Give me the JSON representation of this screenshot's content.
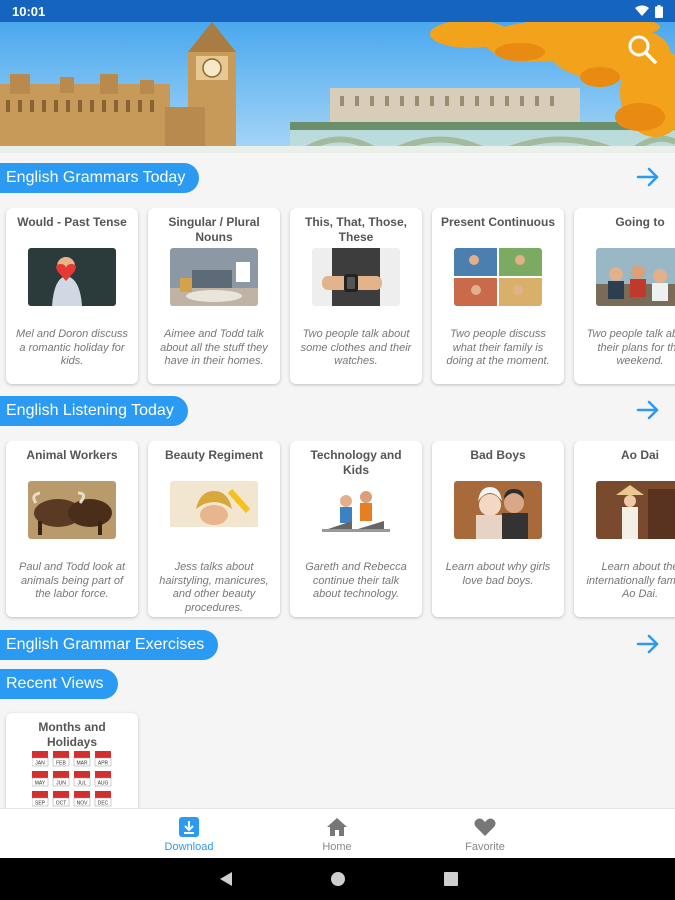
{
  "status_bar": {
    "time": "10:01"
  },
  "sections": {
    "grammar_today": {
      "label": "English Grammars Today"
    },
    "listening_today": {
      "label": "English Listening Today"
    },
    "grammar_exercises": {
      "label": "English Grammar Exercises"
    },
    "recent_views": {
      "label": "Recent Views"
    }
  },
  "grammar_cards": [
    {
      "title": "Would - Past Tense",
      "desc": "Mel and Doron discuss a romantic holiday for kids."
    },
    {
      "title": "Singular / Plural Nouns",
      "desc": "Aimee and Todd talk about all the stuff they have in their homes."
    },
    {
      "title": "This, That, Those, These",
      "desc": "Two people talk about some clothes and their watches."
    },
    {
      "title": "Present Continuous",
      "desc": "Two people discuss what their family is doing at the moment."
    },
    {
      "title": "Going to",
      "desc": "Two people talk about their plans for the weekend."
    }
  ],
  "listening_cards": [
    {
      "title": "Animal Workers",
      "desc": "Paul and Todd look at animals being part of the labor force."
    },
    {
      "title": "Beauty Regiment",
      "desc": "Jess talks about hairstyling, manicures, and other beauty procedures."
    },
    {
      "title": "Technology and Kids",
      "desc": "Gareth and Rebecca continue their talk about technology."
    },
    {
      "title": "Bad Boys",
      "desc": "Learn about why girls love bad boys."
    },
    {
      "title": "Ao Dai",
      "desc": "Learn about the internationally famous Ao Dai."
    }
  ],
  "recent_cards": [
    {
      "title": "Months and Holidays"
    }
  ],
  "calendar_months": [
    "JAN",
    "FEB",
    "MAR",
    "APR",
    "MAY",
    "JUN",
    "JUL",
    "AUG",
    "SEP",
    "OCT",
    "NOV",
    "DEC"
  ],
  "bottom_nav": {
    "download": "Download",
    "home": "Home",
    "favorite": "Favorite"
  },
  "colors": {
    "accent": "#2b9af3",
    "status_bar": "#1565c0"
  },
  "icons": {
    "search": "search-icon",
    "arrow": "arrow-right-icon",
    "download": "download-icon",
    "home": "home-icon",
    "favorite": "heart-icon"
  }
}
